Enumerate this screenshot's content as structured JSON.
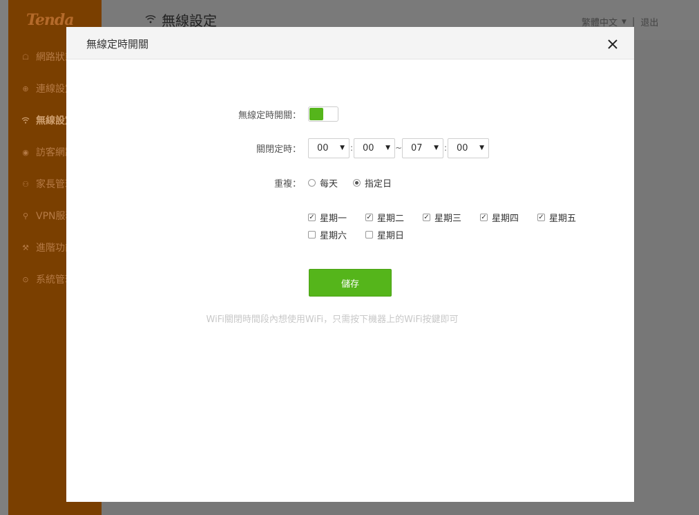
{
  "app": {
    "logo": "Tenda",
    "page_title": "無線設定",
    "language": "繁體中文",
    "logout": "退出"
  },
  "sidebar": {
    "items": [
      {
        "label": "網路狀態",
        "icon": "router-icon"
      },
      {
        "label": "連線設定",
        "icon": "globe-icon"
      },
      {
        "label": "無線設定",
        "icon": "wifi-icon"
      },
      {
        "label": "訪客網路",
        "icon": "location-icon"
      },
      {
        "label": "家長管理",
        "icon": "family-icon"
      },
      {
        "label": "VPN服務",
        "icon": "vpn-icon"
      },
      {
        "label": "進階功能",
        "icon": "wrench-icon"
      },
      {
        "label": "系統管理",
        "icon": "gear-icon"
      }
    ]
  },
  "modal": {
    "title": "無線定時開關",
    "enable_label": "無線定時開關：",
    "enable_on": true,
    "schedule_label": "關閉定時：",
    "start_hour": "00",
    "start_min": "00",
    "tilde": "~",
    "end_hour": "07",
    "end_min": "00",
    "time_sep": ":",
    "repeat_label": "重複：",
    "repeat_options": [
      "每天",
      "指定日"
    ],
    "repeat_selected": "指定日",
    "days_row1": [
      {
        "label": "星期一",
        "checked": true
      },
      {
        "label": "星期二",
        "checked": true
      },
      {
        "label": "星期三",
        "checked": true
      },
      {
        "label": "星期四",
        "checked": true
      },
      {
        "label": "星期五",
        "checked": true
      }
    ],
    "days_row2": [
      {
        "label": "星期六",
        "checked": false
      },
      {
        "label": "星期日",
        "checked": false
      }
    ],
    "save_label": "儲存",
    "hint": "WiFi關閉時間段內想使用WiFi，只需按下機器上的WiFi按鍵即可"
  },
  "colors": {
    "accent": "#55b51b",
    "sidebar_bg": "#7a3f00"
  }
}
